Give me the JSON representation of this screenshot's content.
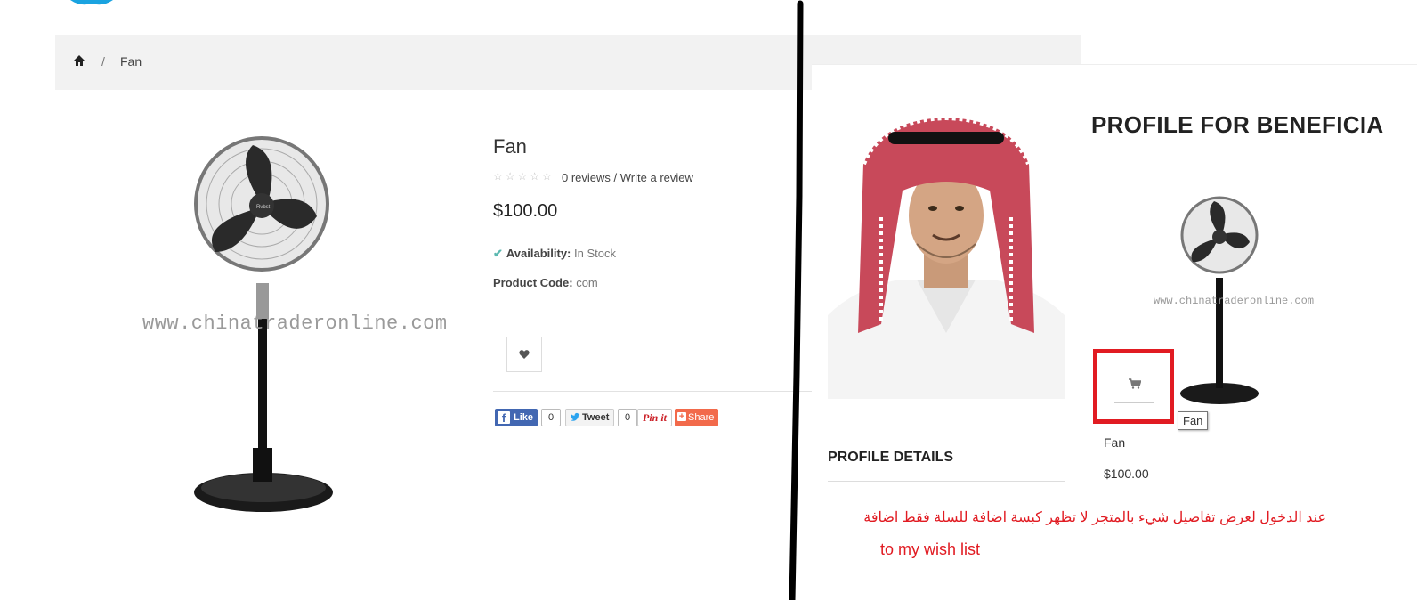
{
  "breadcrumb": {
    "home_icon": "home-icon",
    "separator": "/",
    "current": "Fan"
  },
  "product": {
    "title": "Fan",
    "rating_stars": "☆☆☆☆☆",
    "reviews_count": "0 reviews",
    "reviews_sep": " / ",
    "write_review": "Write a review",
    "price": "$100.00",
    "availability_label": "Availability:",
    "availability_value": "In Stock",
    "code_label": "Product Code:",
    "code_value": "com",
    "watermark": "www.chinatraderonline.com",
    "wishlist_icon": "heart-icon"
  },
  "social": {
    "like_label": "Like",
    "like_count": "0",
    "tweet_label": "Tweet",
    "tweet_count": "0",
    "pin_label": "Pin it",
    "share_label": "Share"
  },
  "right": {
    "heading": "PROFILE FOR BENEFICIA",
    "thumb_watermark": "www.chinatraderonline.com",
    "cart_icon": "cart-icon",
    "tooltip": "Fan",
    "item_name": "Fan",
    "item_price": "$100.00",
    "profile_details": "PROFILE DETAILS",
    "note_arabic": "عند الدخول لعرض تفاصيل شيء بالمتجر لا تظهر كبسة اضافة للسلة فقط اضافة",
    "note_english": "to my wish list",
    "accent_color": "#e11b22"
  }
}
